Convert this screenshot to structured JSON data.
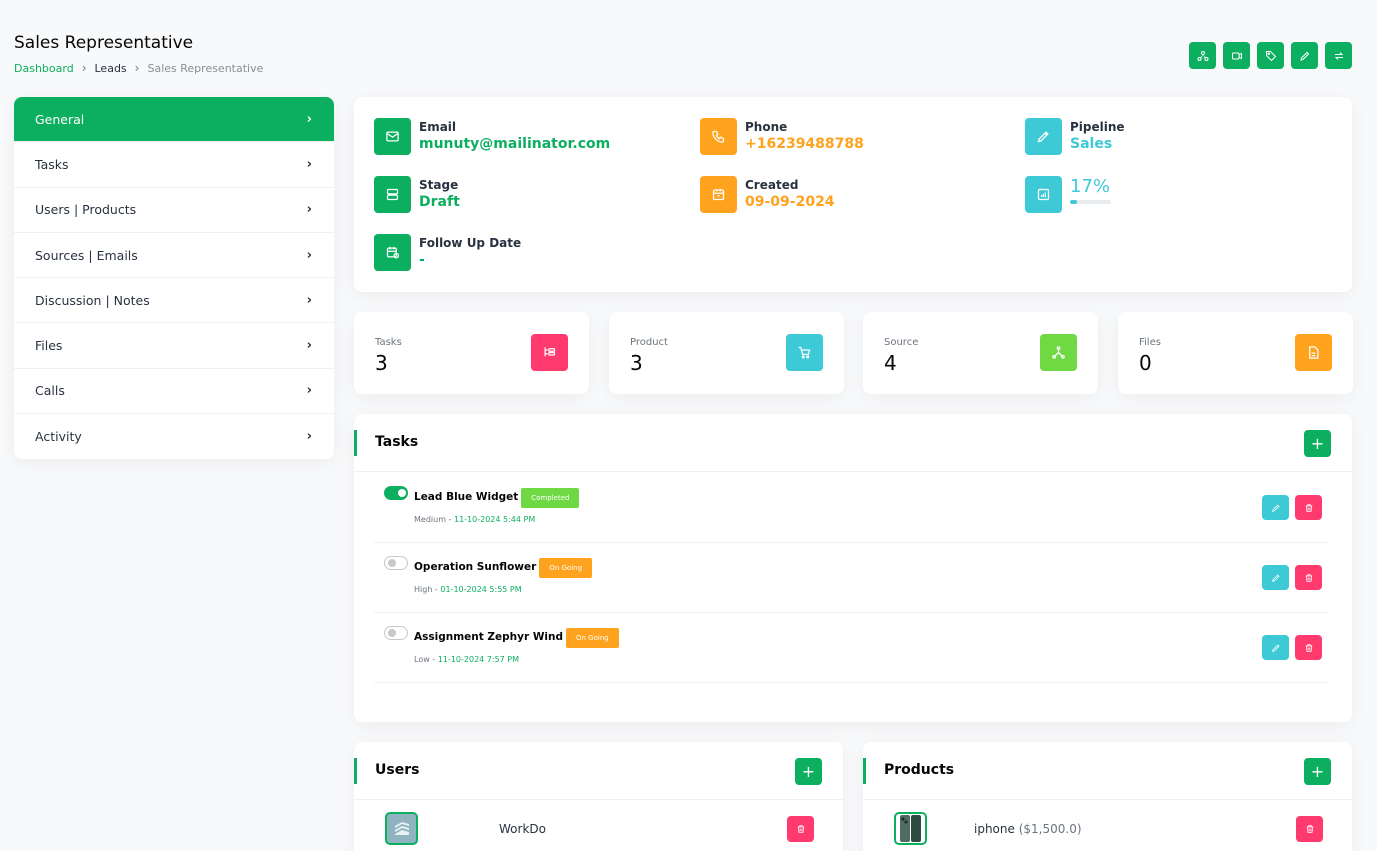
{
  "header": {
    "title": "Sales Representative",
    "breadcrumb": [
      "Dashboard",
      "Leads",
      "Sales Representative"
    ],
    "actions": [
      "share-icon",
      "video-icon",
      "tag-icon",
      "edit-icon",
      "convert-icon"
    ]
  },
  "sidebar": {
    "items": [
      {
        "label": "General",
        "active": true
      },
      {
        "label": "Tasks"
      },
      {
        "label": "Users | Products"
      },
      {
        "label": "Sources | Emails"
      },
      {
        "label": "Discussion | Notes"
      },
      {
        "label": "Files"
      },
      {
        "label": "Calls"
      },
      {
        "label": "Activity"
      }
    ]
  },
  "info": {
    "email": {
      "label": "Email",
      "value": "munuty@mailinator.com"
    },
    "phone": {
      "label": "Phone",
      "value": "+16239488788"
    },
    "pipeline": {
      "label": "Pipeline",
      "value": "Sales"
    },
    "stage": {
      "label": "Stage",
      "value": "Draft"
    },
    "created": {
      "label": "Created",
      "value": "09-09-2024"
    },
    "progress": {
      "value": "17%",
      "fraction": 0.17
    },
    "followup": {
      "label": "Follow Up Date",
      "value": "-"
    }
  },
  "stats": [
    {
      "label": "Tasks",
      "value": "3"
    },
    {
      "label": "Product",
      "value": "3"
    },
    {
      "label": "Source",
      "value": "4"
    },
    {
      "label": "Files",
      "value": "0"
    }
  ],
  "tasks": {
    "title": "Tasks",
    "add": "+",
    "rows": [
      {
        "name": "Lead Blue Widget",
        "status": "Completed",
        "priority": "Medium",
        "date": "11-10-2024 5:44 PM",
        "done": true
      },
      {
        "name": "Operation Sunflower",
        "status": "On Going",
        "priority": "High",
        "date": "01-10-2024 5:55 PM",
        "done": false
      },
      {
        "name": "Assignment Zephyr Wind",
        "status": "On Going",
        "priority": "Low",
        "date": "11-10-2024 7:57 PM",
        "done": false
      }
    ]
  },
  "users": {
    "title": "Users",
    "add": "+",
    "rows": [
      {
        "name": "WorkDo"
      }
    ]
  },
  "products": {
    "title": "Products",
    "add": "+",
    "rows": [
      {
        "name": "iphone",
        "price": "($1,500.0)"
      }
    ]
  },
  "colors": {
    "primary": "#0caf60",
    "orange": "#ffa21d",
    "teal": "#3ec9d6",
    "pink": "#ff3a6e",
    "lime": "#6fd943"
  }
}
